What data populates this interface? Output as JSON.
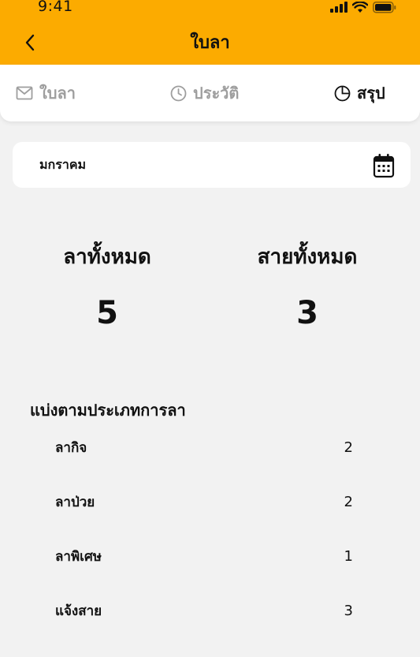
{
  "status_bar": {
    "time": "9:41"
  },
  "header": {
    "title": "ใบลา"
  },
  "tabs": [
    {
      "label": "ใบลา",
      "icon": "mail-icon",
      "active": false
    },
    {
      "label": "ประวัติ",
      "icon": "clock-icon",
      "active": false
    },
    {
      "label": "สรุป",
      "icon": "pie-chart-icon",
      "active": true
    }
  ],
  "month_selector": {
    "value": "มกราคม",
    "icon": "calendar-icon"
  },
  "totals": {
    "leave": {
      "label": "ลาทั้งหมด",
      "value": "5"
    },
    "late": {
      "label": "สายทั้งหมด",
      "value": "3"
    }
  },
  "breakdown": {
    "title": "แบ่งตามประเภทการลา",
    "items": [
      {
        "label": "ลากิจ",
        "count": "2"
      },
      {
        "label": "ลาป่วย",
        "count": "2"
      },
      {
        "label": "ลาพิเศษ",
        "count": "1"
      },
      {
        "label": "แจ้งสาย",
        "count": "3"
      }
    ]
  },
  "colors": {
    "accent": "#fcab00",
    "background": "#f2f2f2",
    "inactive": "#9e9e9e"
  }
}
